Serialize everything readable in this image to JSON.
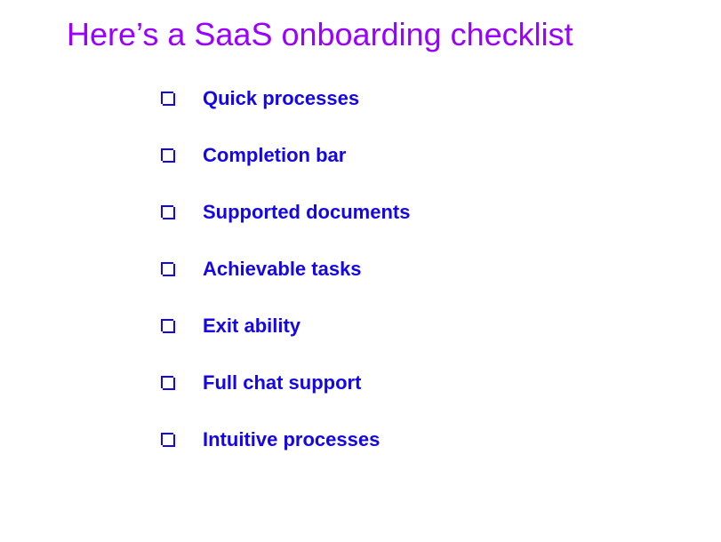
{
  "title": "Here’s a SaaS onboarding checklist",
  "items": [
    {
      "label": "Quick processes"
    },
    {
      "label": "Completion bar"
    },
    {
      "label": "Supported documents"
    },
    {
      "label": "Achievable tasks"
    },
    {
      "label": "Exit ability"
    },
    {
      "label": "Full chat support"
    },
    {
      "label": "Intuitive processes"
    }
  ],
  "colors": {
    "title": "#9900ff",
    "item": "#1506e5"
  }
}
